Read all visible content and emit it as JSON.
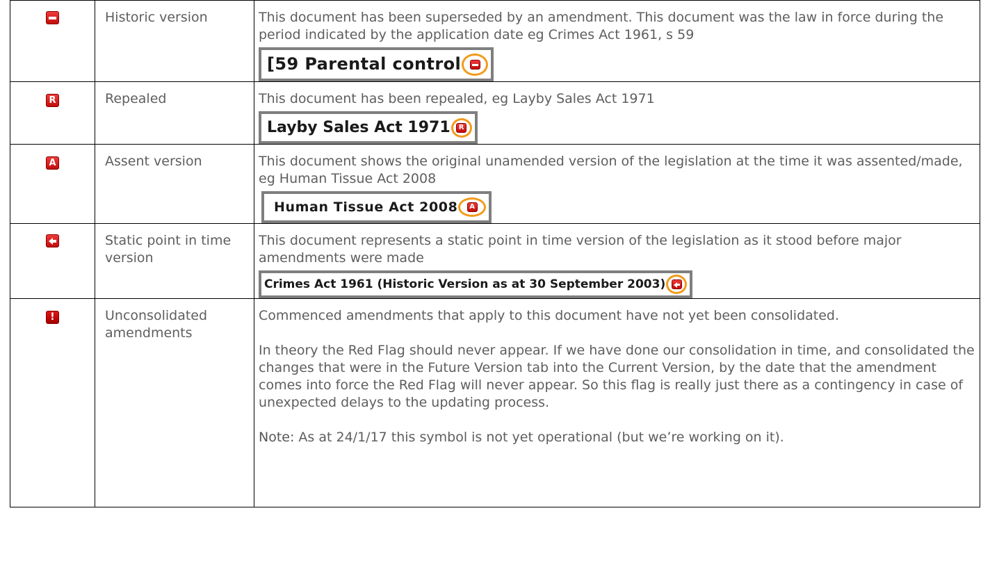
{
  "rows": [
    {
      "icon": "historic-icon",
      "name": "Historic version",
      "description": "This document has been superseded by an amendment. This document was the law in force during the period indicated by the application date eg Crimes Act 1961, s 59",
      "example": "[59 Parental control"
    },
    {
      "icon": "repealed-icon",
      "icon_letter": "R",
      "name": "Repealed",
      "description": "This document has been repealed, eg Layby Sales Act 1971",
      "example": "Layby Sales Act 1971"
    },
    {
      "icon": "assent-icon",
      "icon_letter": "A",
      "name": "Assent version",
      "description": "This document shows the original unamended version of the legislation at the time it was assented/made, eg Human Tissue Act 2008",
      "example": "Human Tissue Act 2008"
    },
    {
      "icon": "static-point-icon",
      "name": "Static point in time version",
      "description": "This document represents a static point in time version of the legislation as it stood before major amendments were made",
      "example": "Crimes Act 1961 (Historic Version as at 30 September 2003)"
    },
    {
      "icon": "red-flag-icon",
      "icon_letter": "!",
      "name": "Unconsolidated amendments",
      "description": "Commenced amendments that apply to this document have not yet been consolidated.",
      "paragraph_2": "In theory the Red Flag should never appear. If we have done our consolidation in time, and consolidated the changes that were in the Future Version tab into the Current Version, by the date that the amendment comes into force the Red Flag will never appear.  So this flag is really just there as a contingency in case of unexpected delays to the updating process.",
      "note_label": "Note:",
      "note_text": "  As at 24/1/17 this symbol is not yet operational (but we’re working on it)."
    }
  ],
  "colors": {
    "icon_red": "#e02020",
    "highlight_ring": "#f29a1c",
    "example_border": "#7f7f7f"
  }
}
